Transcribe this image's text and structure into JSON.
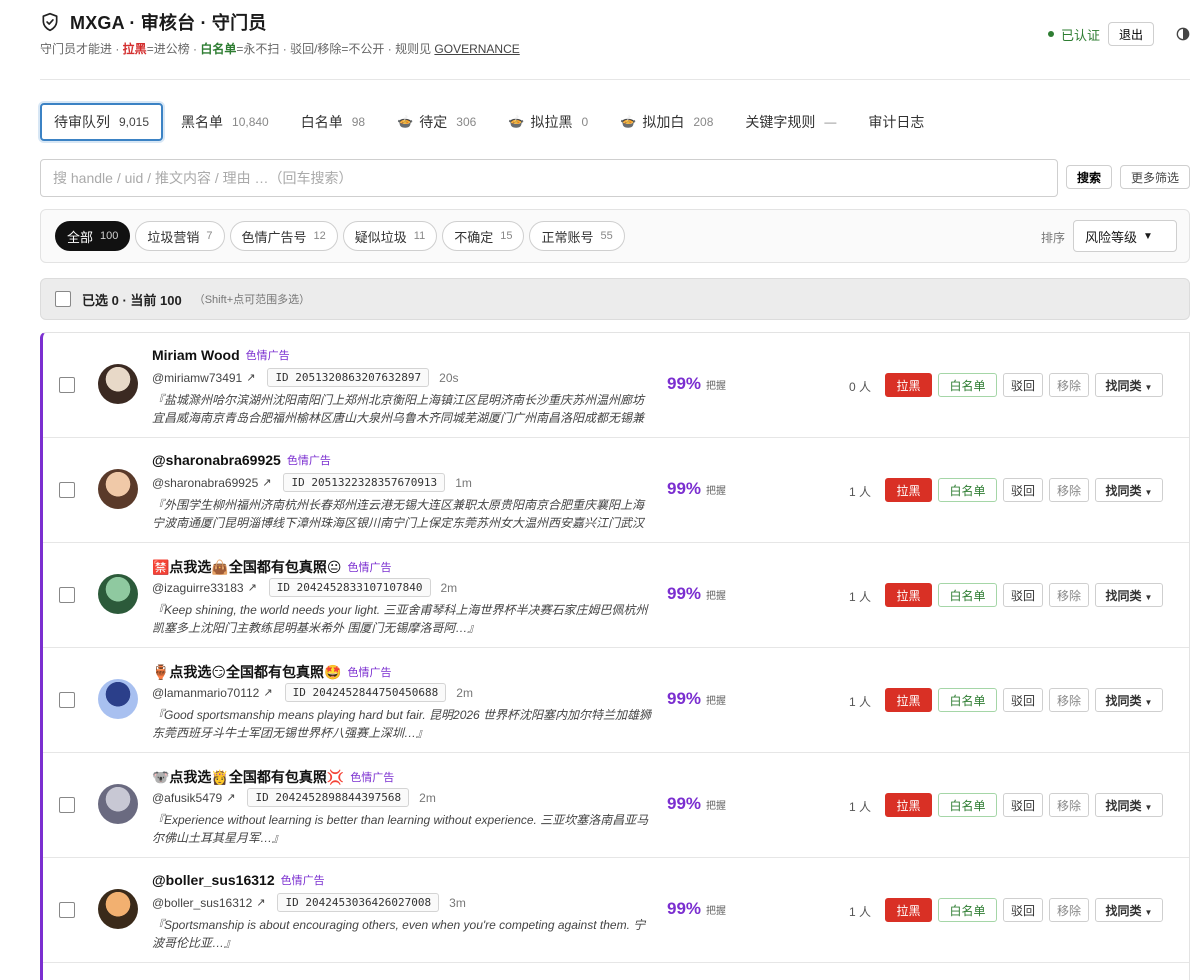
{
  "header": {
    "title": "MXGA · 审核台 · 守门员",
    "subtitle_prefix": "守门员才能进 · ",
    "blacklist_word": "拉黑",
    "blacklist_desc": "=进公榜 · ",
    "whitelist_word": "白名单",
    "whitelist_desc": "=永不扫 · 驳回/移除=不公开 · 规则见 ",
    "governance_link": "GOVERNANCE",
    "verified": "已认证",
    "logout": "退出"
  },
  "tabs": [
    {
      "label": "待审队列",
      "count": "9,015",
      "icon": ""
    },
    {
      "label": "黑名单",
      "count": "10,840",
      "icon": ""
    },
    {
      "label": "白名单",
      "count": "98",
      "icon": ""
    },
    {
      "label": "待定",
      "count": "306",
      "icon": "pot-icon"
    },
    {
      "label": "拟拉黑",
      "count": "0",
      "icon": "pot-icon"
    },
    {
      "label": "拟加白",
      "count": "208",
      "icon": "pot-icon"
    },
    {
      "label": "关键字规则",
      "count": "—",
      "icon": ""
    },
    {
      "label": "审计日志",
      "count": "",
      "icon": ""
    }
  ],
  "search": {
    "placeholder": "搜 handle / uid / 推文内容 / 理由 …（回车搜索）",
    "search_button": "搜索",
    "more_button": "更多筛选"
  },
  "filters": {
    "chips": [
      {
        "label": "全部",
        "count": "100"
      },
      {
        "label": "垃圾营销",
        "count": "7"
      },
      {
        "label": "色情广告号",
        "count": "12"
      },
      {
        "label": "疑似垃圾",
        "count": "11"
      },
      {
        "label": "不确定",
        "count": "15"
      },
      {
        "label": "正常账号",
        "count": "55"
      }
    ],
    "sort_label": "排序",
    "sort_value": "风险等级"
  },
  "selection": {
    "text": "已选 0 · 当前 100",
    "hint": "（Shift+点可范围多选）"
  },
  "actions": {
    "block": "拉黑",
    "whitelist": "白名单",
    "reject": "驳回",
    "remove": "移除",
    "similar": "找同类"
  },
  "confidence_label": "把握",
  "rows": [
    {
      "name": "Miriam Wood",
      "tag": "色情广告",
      "handle": "@miriamw73491",
      "id": "ID 2051320863207632897",
      "age": "20s",
      "excerpt": "『盐城滁州哈尔滨湖州沈阳南阳门上郑州北京衡阳上海镇江区昆明济南长沙重庆苏州温州廊坊宜昌威海南京青岛合肥福州榆林区唐山大泉州乌鲁木齐同城芜湖厦门广州南昌洛阳成都无锡兼职区…",
      "score": "99%",
      "people": "0 人"
    },
    {
      "name": "@sharonabra69925",
      "tag": "色情广告",
      "handle": "@sharonabra69925",
      "id": "ID 2051322328357670913",
      "age": "1m",
      "excerpt": "『外围学生柳州福州济南杭州长春郑州连云港无锡大连区兼职太原贵阳南京合肥重庆襄阳上海宁波南通厦门昆明淄博线下漳州珠海区银川南宁门上保定东莞苏州女大温州西安嘉兴江门武汉长沙区…",
      "score": "99%",
      "people": "1 人"
    },
    {
      "name": "🈲点我选👜全国都有包真照😐",
      "tag": "色情广告",
      "handle": "@izaguirre33183",
      "id": "ID 2042452833107107840",
      "age": "2m",
      "excerpt": "『Keep shining, the world needs your light. 三亚舍甫琴科上海世界杯半决赛石家庄姆巴佩杭州凯塞多上沈阳门主教练昆明基米希外 围厦门无锡摩洛哥阿…』",
      "score": "99%",
      "people": "1 人"
    },
    {
      "name": "🏺点我选😏全国都有包真照🤩",
      "tag": "色情广告",
      "handle": "@lamanmario70112",
      "id": "ID 2042452844750450688",
      "age": "2m",
      "excerpt": "『Good sportsmanship means playing hard but fair. 昆明2026 世界杯沈阳塞内加尔特兰加雄狮东莞西班牙斗牛士军团无锡世界杯八强赛上深圳…』",
      "score": "99%",
      "people": "1 人"
    },
    {
      "name": "🐨点我选👸全国都有包真照💢",
      "tag": "色情广告",
      "handle": "@afusik5479",
      "id": "ID 2042452898844397568",
      "age": "2m",
      "excerpt": "『Experience without learning is better than learning without experience. 三亚坎塞洛南昌亚马尔佛山土耳其星月军…』",
      "score": "99%",
      "people": "1 人"
    },
    {
      "name": "@boller_sus16312",
      "tag": "色情广告",
      "handle": "@boller_sus16312",
      "id": "ID 2042453036426027008",
      "age": "3m",
      "excerpt": "『Sportsmanship is about encouraging others, even when you're competing against them. 宁波哥伦比亚…』",
      "score": "99%",
      "people": "1 人"
    }
  ],
  "colors": {
    "accent_purple": "#7b2fd0",
    "block_red": "#d93025",
    "whitelist_green": "#2e7d32"
  }
}
